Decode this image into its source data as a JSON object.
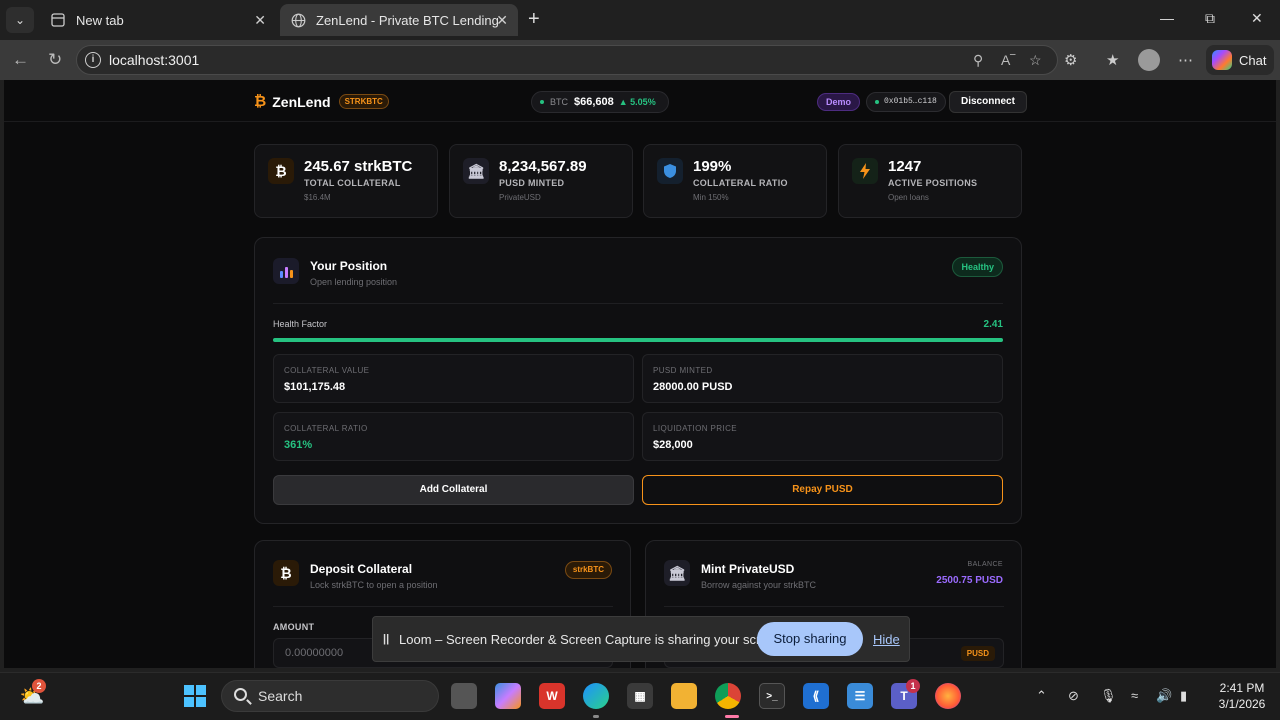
{
  "browser": {
    "tabs": [
      {
        "title": "New tab"
      },
      {
        "title": "ZenLend - Private BTC Lending"
      }
    ],
    "url": "localhost:3001",
    "chat_label": "Chat"
  },
  "app": {
    "brand_name": "ZenLend",
    "brand_tag": "STRKBTC",
    "price": {
      "label": "BTC",
      "value": "$66,608",
      "change": "▲ 5.05%"
    },
    "demo_label": "Demo",
    "address": "0x01b5…c118",
    "disconnect_label": "Disconnect"
  },
  "stats": [
    {
      "value": "245.67 strkBTC",
      "label": "TOTAL COLLATERAL",
      "sub": "$16.4M",
      "icon": "bitcoin-icon"
    },
    {
      "value": "8,234,567.89",
      "label": "PUSD MINTED",
      "sub": "PrivateUSD",
      "icon": "bank-icon"
    },
    {
      "value": "199%",
      "label": "COLLATERAL RATIO",
      "sub": "Min 150%",
      "icon": "shield-icon"
    },
    {
      "value": "1247",
      "label": "ACTIVE POSITIONS",
      "sub": "Open loans",
      "icon": "lightning-icon"
    }
  ],
  "position": {
    "title": "Your Position",
    "subtitle": "Open lending position",
    "status": "Healthy",
    "health_label": "Health Factor",
    "health_value": "2.41",
    "health_fill_fraction": 1.0,
    "metrics": [
      {
        "label": "COLLATERAL VALUE",
        "value": "$101,175.48"
      },
      {
        "label": "PUSD MINTED",
        "value": "28000.00 PUSD"
      },
      {
        "label": "COLLATERAL RATIO",
        "value": "361%"
      },
      {
        "label": "LIQUIDATION PRICE",
        "value": "$28,000"
      }
    ],
    "add_label": "Add Collateral",
    "repay_label": "Repay PUSD"
  },
  "deposit": {
    "title": "Deposit Collateral",
    "subtitle": "Lock strkBTC to open a position",
    "tag": "strkBTC",
    "amount_label": "AMOUNT",
    "amount_placeholder": "0.00000000"
  },
  "mint": {
    "title": "Mint PrivateUSD",
    "subtitle": "Borrow against your strkBTC",
    "balance_label": "BALANCE",
    "balance_value": "2500.75 PUSD",
    "unit_tag": "PUSD"
  },
  "loom": {
    "message": "Loom – Screen Recorder & Screen Capture is sharing your screen.",
    "stop_label": "Stop sharing",
    "hide_label": "Hide"
  },
  "taskbar": {
    "search_label": "Search",
    "weather_badge": "2",
    "teams_badge": "1",
    "time": "2:41 PM",
    "date": "3/1/2026"
  },
  "colors": {
    "accent_orange": "#f7931a",
    "accent_green": "#26c281",
    "accent_purple": "#9b6bff"
  }
}
